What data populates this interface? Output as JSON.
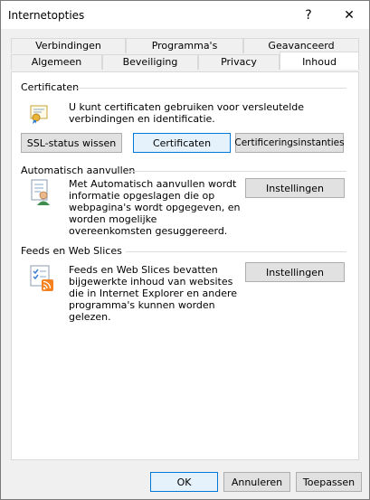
{
  "window": {
    "title": "Internetopties",
    "help_symbol": "?",
    "close_symbol": "✕"
  },
  "tabs": {
    "row_back": [
      "Verbindingen",
      "Programma's",
      "Geavanceerd"
    ],
    "row_front": [
      "Algemeen",
      "Beveiliging",
      "Privacy",
      "Inhoud"
    ],
    "active": "Inhoud"
  },
  "certificates": {
    "title": "Certificaten",
    "description": "U kunt certificaten gebruiken voor versleutelde verbindingen en identificatie.",
    "buttons": {
      "ssl": "SSL-status wissen",
      "certificates": "Certificaten",
      "authorities": "Certificeringsinstanties"
    }
  },
  "autocomplete": {
    "title": "Automatisch aanvullen",
    "description": "Met Automatisch aanvullen wordt informatie opgeslagen die op webpagina's wordt opgegeven, en worden mogelijke overeenkomsten gesuggereerd.",
    "settings_label": "Instellingen"
  },
  "feeds": {
    "title": "Feeds en Web Slices",
    "description": "Feeds en Web Slices bevatten bijgewerkte inhoud van websites die in Internet Explorer en andere programma's kunnen worden gelezen.",
    "settings_label": "Instellingen"
  },
  "footer": {
    "ok": "OK",
    "cancel": "Annuleren",
    "apply": "Toepassen"
  },
  "icons": {
    "certificate": "certificate-icon",
    "autocomplete": "autocomplete-form-icon",
    "feeds": "feeds-rss-icon"
  },
  "colors": {
    "focus_border": "#0078d7",
    "rss_orange": "#f58220"
  }
}
